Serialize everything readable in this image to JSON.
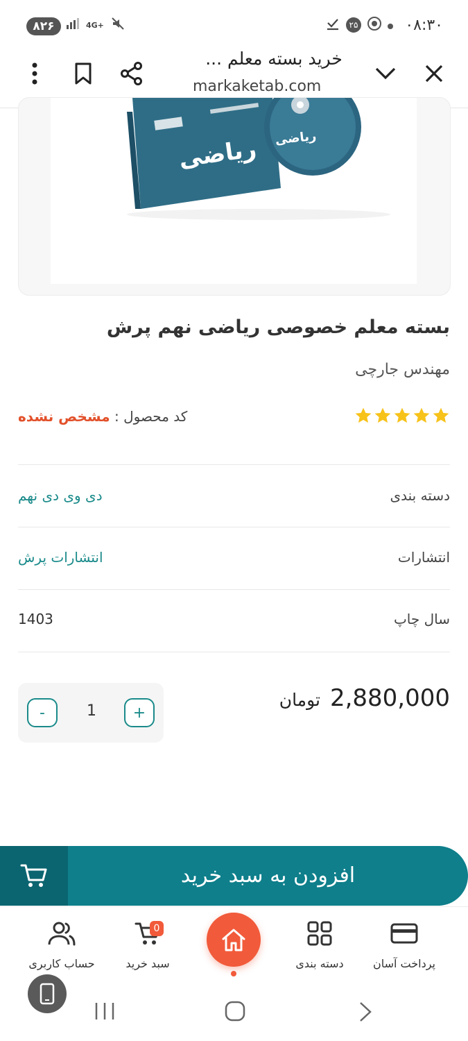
{
  "status_bar": {
    "battery": "۸۲۶",
    "network": "4G+",
    "circle_badge": "۲۵",
    "time": "۰۸:۳۰"
  },
  "browser": {
    "page_title": "خرید بسته معلم ...",
    "url": "markaketab.com"
  },
  "product": {
    "image_alt": "ریاضی",
    "title": "بسته معلم خصوصی ریاضی نهم پرش",
    "author": "مهندس جارچی",
    "rating": 5,
    "code_label": "کد محصول :",
    "code_value": "مشخص نشده",
    "attributes": [
      {
        "label": "دسته بندی",
        "value": "دی وی دی نهم"
      },
      {
        "label": "انتشارات",
        "value": "انتشارات پرش"
      },
      {
        "label": "سال چاپ",
        "value": "1403"
      }
    ],
    "price": "2,880,000",
    "currency": "تومان"
  },
  "quantity": {
    "value": "1",
    "plus": "+",
    "minus": "-"
  },
  "cart_button": {
    "label": "افزودن به سبد خرید"
  },
  "bottom_nav": {
    "items": [
      {
        "label": "حساب کاربری",
        "icon": "users-icon"
      },
      {
        "label": "سبد خرید",
        "icon": "cart-icon",
        "badge": "0"
      },
      {
        "label": "دسته بندی",
        "icon": "grid-icon"
      },
      {
        "label": "پرداخت آسان",
        "icon": "card-icon"
      }
    ]
  },
  "colors": {
    "teal": "#0e7f8b",
    "orange": "#f15a3a",
    "star": "#f7c21a"
  }
}
